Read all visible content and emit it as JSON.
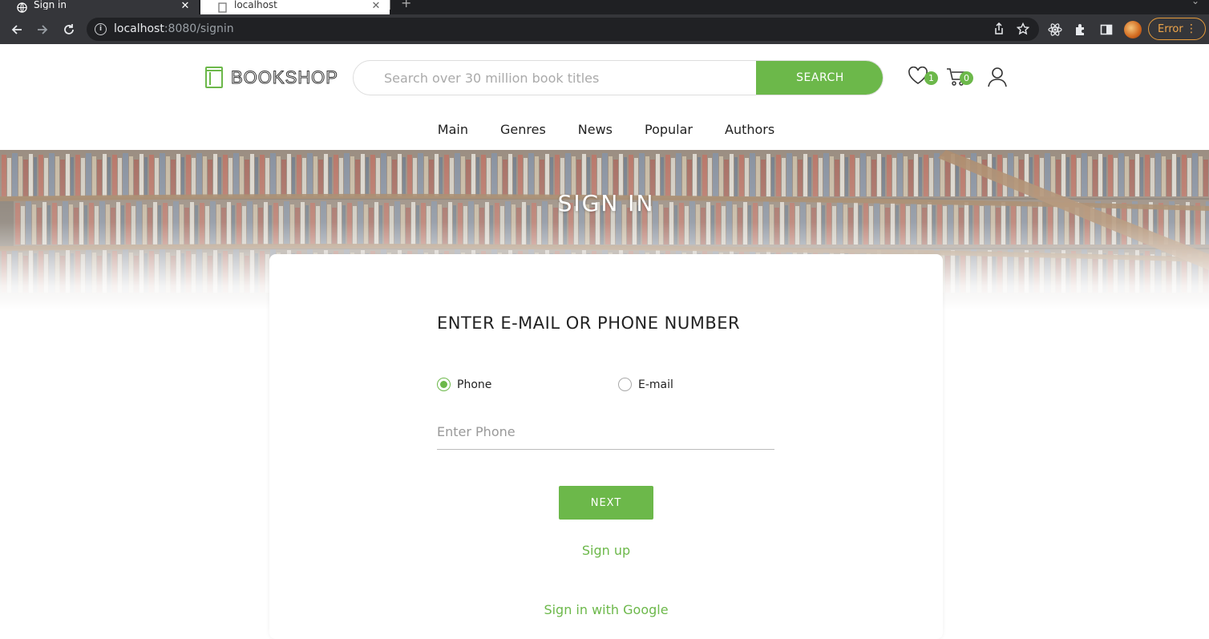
{
  "browser": {
    "tabs": [
      {
        "title": "Sign in",
        "active": true
      },
      {
        "title": "localhost",
        "active": false
      }
    ],
    "url_host": "localhost",
    "url_rest": ":8080/signin",
    "error_label": "Error"
  },
  "header": {
    "logo_text": "BOOKSHOP",
    "search_placeholder": "Search over 30 million book titles",
    "search_button": "SEARCH",
    "wishlist_count": "1",
    "cart_count": "0"
  },
  "nav": {
    "items": [
      "Main",
      "Genres",
      "News",
      "Popular",
      "Authors"
    ]
  },
  "hero": {
    "title": "SIGN IN"
  },
  "form": {
    "title": "ENTER E-MAIL OR PHONE NUMBER",
    "options": [
      {
        "label": "Phone",
        "checked": true
      },
      {
        "label": "E-mail",
        "checked": false
      }
    ],
    "input_placeholder": "Enter Phone",
    "input_value": "",
    "next_button": "NEXT",
    "signup_link": "Sign up",
    "google_link": "Sign in with Google"
  },
  "colors": {
    "accent": "#6cb84a",
    "text": "#222222",
    "chrome_dark": "#35363a",
    "error": "#e49a3b"
  }
}
